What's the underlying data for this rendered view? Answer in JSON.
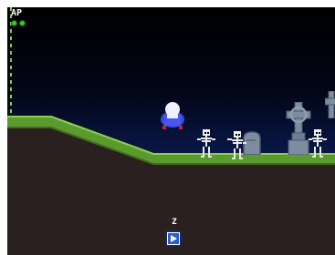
{
  "hud": {
    "ap_label": "AP",
    "ap_points": 2
  },
  "prompt": {
    "key_label": "Z",
    "icon": "play-arrow-icon"
  },
  "scene": {
    "player": "ghost-hero-sprite",
    "enemies": [
      "skeleton-sprite",
      "skeleton-sprite",
      "skeleton-sprite"
    ],
    "props": [
      "tombstone",
      "celtic-cross-grave",
      "celtic-cross-grave"
    ]
  },
  "colors": {
    "sky_top": "#000000",
    "sky_bottom": "#163278",
    "grass": "#5a9a2e",
    "grass_light": "#8ad04a",
    "dirt": "#2b2020",
    "hud_green": "#33cc33",
    "button_border": "#1b2a55"
  }
}
